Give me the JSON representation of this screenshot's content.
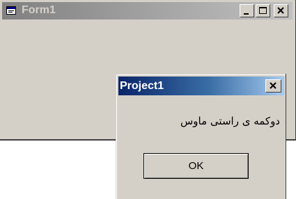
{
  "form1": {
    "title": "Form1",
    "icon": "form-window-icon",
    "caption_buttons": [
      "minimize-icon",
      "maximize-icon",
      "close-icon"
    ]
  },
  "msgbox": {
    "title": "Project1",
    "message": "دوکمه ی راستی ماوس",
    "ok_label": "OK",
    "close_icon": "close-icon"
  },
  "colors": {
    "face": "#d4d0c8",
    "active_title_start": "#0a246a",
    "active_title_end": "#a6caf0",
    "inactive_title_start": "#808080",
    "inactive_title_end": "#c0c0c0"
  }
}
